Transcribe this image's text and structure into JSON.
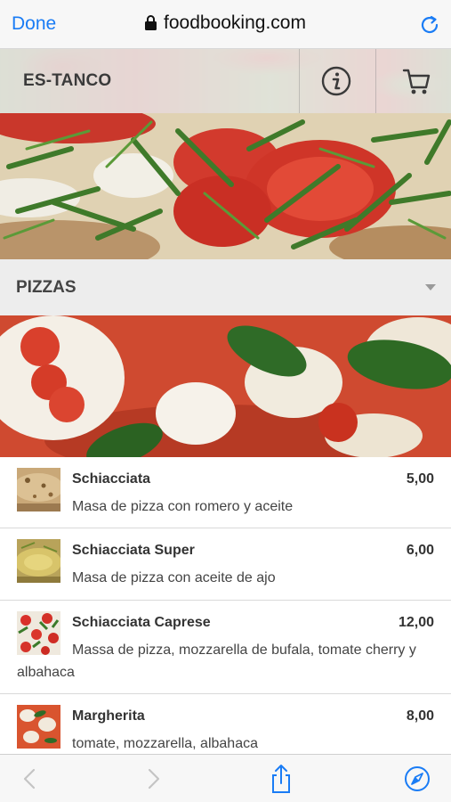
{
  "browser": {
    "done_label": "Done",
    "url": "foodbooking.com"
  },
  "restaurant": {
    "name": "ES-TANCO"
  },
  "category": {
    "title": "PIZZAS"
  },
  "menu_items": [
    {
      "name": "Schiacciata",
      "price": "5,00",
      "description": "Masa de pizza con romero y aceite"
    },
    {
      "name": "Schiacciata Super",
      "price": "6,00",
      "description": "Masa de pizza con aceite de ajo"
    },
    {
      "name": "Schiacciata Caprese",
      "price": "12,00",
      "description": "Massa de pizza, mozzarella de bufala, tomate cherry y albahaca"
    },
    {
      "name": "Margherita",
      "price": "8,00",
      "description": "tomate, mozzarella, albahaca"
    }
  ],
  "icons": {
    "lock": "lock-icon",
    "reload": "reload-icon",
    "info": "info-icon",
    "cart": "cart-icon",
    "caret": "chevron-down-icon",
    "back": "back-icon",
    "forward": "forward-icon",
    "share": "share-icon",
    "bookmarks": "compass-icon"
  },
  "colors": {
    "ios_blue": "#1a7cf5",
    "category_bar": "#ededed"
  }
}
